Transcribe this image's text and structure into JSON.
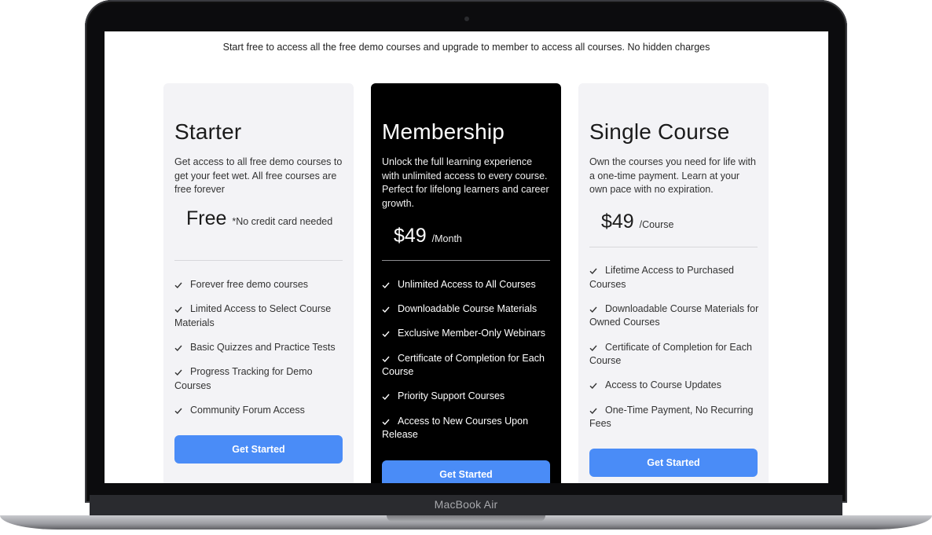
{
  "device": {
    "label": "MacBook Air"
  },
  "tagline": "Start free to access all the free demo courses and upgrade to member to access all courses. No hidden charges",
  "plans": [
    {
      "title": "Starter",
      "description": "Get access to all free demo courses to get your feet wet. All free courses are free forever",
      "price": "Free",
      "price_note": "*No credit card needed",
      "features": [
        "Forever free demo courses",
        "Limited Access to Select Course Materials",
        "Basic Quizzes and Practice Tests",
        "Progress Tracking for Demo Courses",
        "Community Forum Access"
      ],
      "cta": "Get Started"
    },
    {
      "title": "Membership",
      "description": "Unlock the full learning experience with unlimited access to every course. Perfect for lifelong learners and career growth.",
      "price": "$49",
      "price_note": "/Month",
      "features": [
        "Unlimited Access to All Courses",
        "Downloadable Course Materials",
        "Exclusive Member-Only Webinars",
        "Certificate of Completion for Each Course",
        "Priority Support Courses",
        "Access to New Courses Upon Release"
      ],
      "cta": "Get Started"
    },
    {
      "title": "Single Course",
      "description": "Own the courses you need for life with a one-time payment. Learn at your own pace with no expiration.",
      "price": "$49",
      "price_note": "/Course",
      "features": [
        "Lifetime Access to Purchased Courses",
        "Downloadable Course Materials for Owned Courses",
        "Certificate of Completion for Each Course",
        "Access to Course Updates",
        "One-Time Payment, No Recurring Fees"
      ],
      "cta": "Get Started"
    }
  ],
  "colors": {
    "accent": "#4a8cf7",
    "card_light": "#f3f3f6",
    "card_dark": "#000000"
  }
}
